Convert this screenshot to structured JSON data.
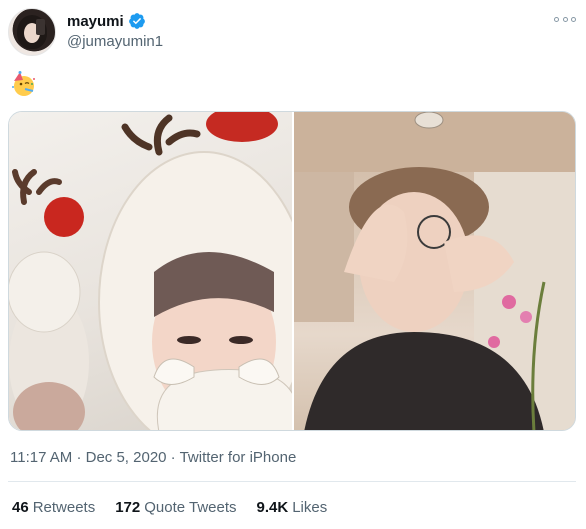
{
  "author": {
    "display_name": "mayumi",
    "handle": "@jumayumin1",
    "verified": true
  },
  "tweet": {
    "emoji": "partying-face-emoji",
    "time": "11:17 AM",
    "separator": "·",
    "date": "Dec 5, 2020",
    "source": "Twitter for iPhone"
  },
  "stats": {
    "retweets_count": "46",
    "retweets_label": "Retweets",
    "quotes_count": "172",
    "quotes_label": "Quote Tweets",
    "likes_count": "9.4K",
    "likes_label": "Likes"
  },
  "icons": {
    "verified": "verified-badge-icon",
    "more": "more-options-icon"
  },
  "colors": {
    "verified_blue": "#1d9bf0",
    "secondary_text": "#536471",
    "primary_text": "#0f1419"
  }
}
